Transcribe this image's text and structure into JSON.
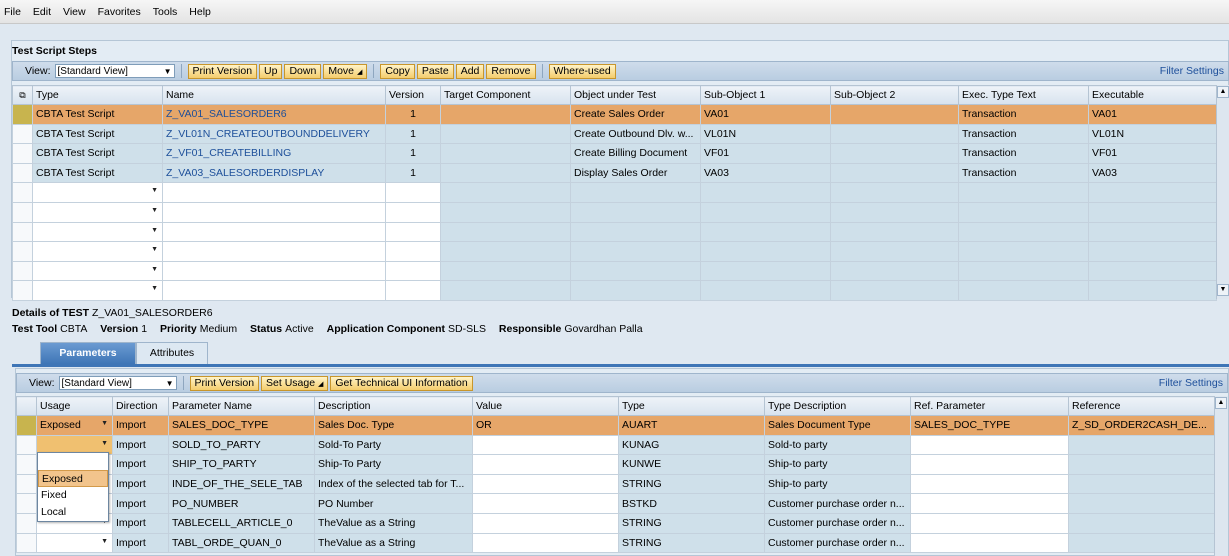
{
  "menu": [
    "File",
    "Edit",
    "View",
    "Favorites",
    "Tools",
    "Help"
  ],
  "steps": {
    "title": "Test Script Steps",
    "view_label": "View:",
    "view_value": "[Standard View]",
    "buttons": [
      "Print Version",
      "Up",
      "Down",
      "Move"
    ],
    "buttons2": [
      "Copy",
      "Paste",
      "Add",
      "Remove"
    ],
    "buttons3": [
      "Where-used"
    ],
    "filter": "Filter Settings",
    "columns": [
      "Type",
      "Name",
      "Version",
      "Target Component",
      "Object under Test",
      "Sub-Object 1",
      "Sub-Object 2",
      "Exec. Type Text",
      "Executable"
    ],
    "rows": [
      {
        "type": "CBTA Test Script",
        "name": "Z_VA01_SALESORDER6",
        "version": "1",
        "target": "",
        "object": "Create Sales Order",
        "sub1": "VA01",
        "sub2": "",
        "exec_type": "Transaction",
        "executable": "VA01"
      },
      {
        "type": "CBTA Test Script",
        "name": "Z_VL01N_CREATEOUTBOUNDDELIVERY",
        "version": "1",
        "target": "",
        "object": "Create Outbound Dlv. w...",
        "sub1": "VL01N",
        "sub2": "",
        "exec_type": "Transaction",
        "executable": "VL01N"
      },
      {
        "type": "CBTA Test Script",
        "name": "Z_VF01_CREATEBILLING",
        "version": "1",
        "target": "",
        "object": "Create Billing Document",
        "sub1": "VF01",
        "sub2": "",
        "exec_type": "Transaction",
        "executable": "VF01"
      },
      {
        "type": "CBTA Test Script",
        "name": "Z_VA03_SALESORDERDISPLAY",
        "version": "1",
        "target": "",
        "object": "Display Sales Order",
        "sub1": "VA03",
        "sub2": "",
        "exec_type": "Transaction",
        "executable": "VA03"
      }
    ]
  },
  "details": {
    "label": "Details of TEST",
    "name": "Z_VA01_SALESORDER6",
    "test_tool_label": "Test Tool",
    "test_tool": "CBTA",
    "version_label": "Version",
    "version": "1",
    "priority_label": "Priority",
    "priority": "Medium",
    "status_label": "Status",
    "status": "Active",
    "app_comp_label": "Application Component",
    "app_comp": "SD-SLS",
    "responsible_label": "Responsible",
    "responsible": "Govardhan Palla"
  },
  "tabs": [
    "Parameters",
    "Attributes"
  ],
  "params": {
    "view_label": "View:",
    "view_value": "[Standard View]",
    "buttons": [
      "Print Version",
      "Set Usage",
      "Get Technical UI Information"
    ],
    "filter": "Filter Settings",
    "columns": [
      "Usage",
      "Direction",
      "Parameter Name",
      "Description",
      "Value",
      "Type",
      "Type Description",
      "Ref. Parameter",
      "Reference"
    ],
    "rows": [
      {
        "usage": "Exposed",
        "direction": "Import",
        "name": "SALES_DOC_TYPE",
        "description": "Sales Doc. Type",
        "value": "OR",
        "type": "AUART",
        "type_desc": "Sales Document Type",
        "ref_param": "SALES_DOC_TYPE",
        "reference": "Z_SD_ORDER2CASH_DE..."
      },
      {
        "usage": "",
        "direction": "Import",
        "name": "SOLD_TO_PARTY",
        "description": "Sold-To Party",
        "value": "",
        "type": "KUNAG",
        "type_desc": "Sold-to party",
        "ref_param": "",
        "reference": ""
      },
      {
        "usage": "",
        "direction": "Import",
        "name": "SHIP_TO_PARTY",
        "description": "Ship-To Party",
        "value": "",
        "type": "KUNWE",
        "type_desc": "Ship-to party",
        "ref_param": "",
        "reference": ""
      },
      {
        "usage": "",
        "direction": "Import",
        "name": "INDE_OF_THE_SELE_TAB",
        "description": "Index of the selected tab for T...",
        "value": "",
        "type": "STRING",
        "type_desc": "Ship-to party",
        "ref_param": "",
        "reference": ""
      },
      {
        "usage": "",
        "direction": "Import",
        "name": "PO_NUMBER",
        "description": "PO Number",
        "value": "",
        "type": "BSTKD",
        "type_desc": "Customer purchase order n...",
        "ref_param": "",
        "reference": ""
      },
      {
        "usage": "",
        "direction": "Import",
        "name": "TABLECELL_ARTICLE_0",
        "description": "TheValue as a String",
        "value": "",
        "type": "STRING",
        "type_desc": "Customer purchase order n...",
        "ref_param": "",
        "reference": ""
      },
      {
        "usage": "",
        "direction": "Import",
        "name": "TABL_ORDE_QUAN_0",
        "description": "TheValue as a String",
        "value": "",
        "type": "STRING",
        "type_desc": "Customer purchase order n...",
        "ref_param": "",
        "reference": ""
      }
    ],
    "usage_options": [
      "Exposed",
      "Fixed",
      "Local"
    ]
  }
}
